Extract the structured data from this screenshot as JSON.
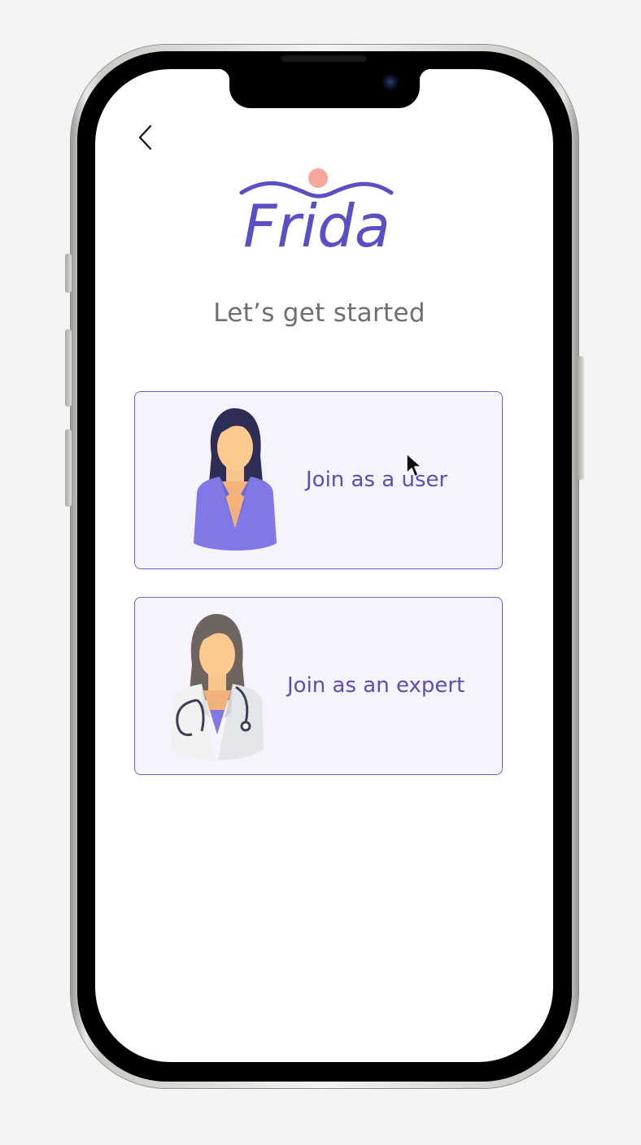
{
  "app": {
    "name": "Frida"
  },
  "header": {
    "back_icon": "chevron-left-icon"
  },
  "logo": {
    "text": "Frida",
    "primary_color": "#5a4fc4",
    "dot_color": "#f6a69a"
  },
  "page": {
    "title": "Let’s get started"
  },
  "options": [
    {
      "label": "Join as a user",
      "icon": "woman-avatar-icon"
    },
    {
      "label": "Join as an expert",
      "icon": "doctor-avatar-icon"
    }
  ],
  "colors": {
    "accent": "#5a4fb8",
    "card_background": "#f5f3fc",
    "card_border": "#6b61c9",
    "title_text": "#6f6f6f"
  }
}
